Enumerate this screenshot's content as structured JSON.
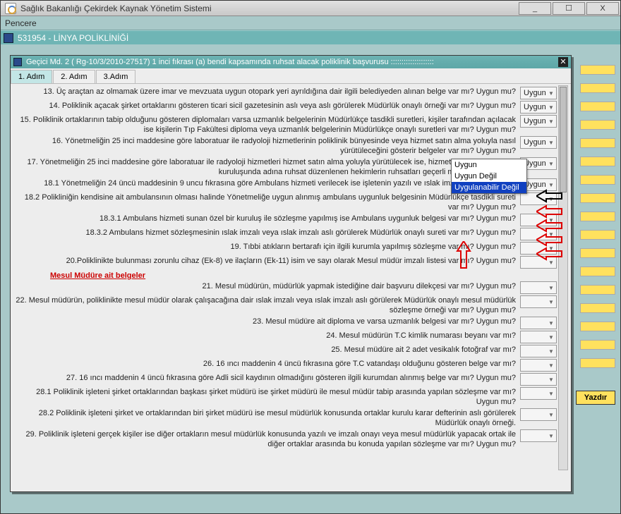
{
  "window": {
    "title": "Sağlık Bakanlığı Çekirdek Kaynak Yönetim Sistemi"
  },
  "menu": {
    "item1": "Pencere"
  },
  "subwindow": {
    "title": "531954 - LİNYA POLİKLİNİĞİ"
  },
  "dialog": {
    "title": "Geçici Md. 2 ( Rg-10/3/2010-27517)  1 inci fıkrası (a)  bendi kapsamında ruhsat alacak poliklinik başvurusu  ::::::::::::::::::::"
  },
  "tabs": [
    "1. Adım",
    "2. Adım",
    "3.Adım"
  ],
  "active_tab": 1,
  "questions": [
    {
      "id": "q13",
      "text": "13. Üç araçtan az olmamak üzere imar ve mevzuata uygun otopark yeri ayrıldığına dair ilgili belediyeden alınan belge var mı? Uygun mu?",
      "value": "Uygun"
    },
    {
      "id": "q14",
      "text": "14. Poliklinik açacak şirket ortaklarını gösteren ticari sicil gazetesinin aslı veya aslı görülerek Müdürlük onaylı örneği var mı? Uygun mu?",
      "value": "Uygun"
    },
    {
      "id": "q15",
      "text": "15. Poliklinik ortaklarının tabip olduğunu gösteren diplomaları varsa uzmanlık belgelerinin Müdürlükçe tasdikli suretleri, kişiler  tarafından açılacak ise kişilerin Tıp Fakültesi diploma veya uzmanlık belgelerinin Müdürlükçe onaylı suretleri var mı? Uygun mu?",
      "value": "Uygun"
    },
    {
      "id": "q16",
      "text": "16. Yönetmeliğin 25 inci maddesine göre laboratuar ile radyoloji hizmetlerinin poliklinik bünyesinde veya hizmet satın alma yoluyla nasıl yürütüleceğini gösterir belgeler var mı? Uygun mu?",
      "value": "Uygun"
    },
    {
      "id": "q17",
      "text": "17. Yönetmeliğin 25 inci maddesine göre laboratuar ile radyoloji hizmetleri hizmet satın alma yoluyla yürütülecek ise, hizmet satın alınan sağlık kuruluşunda adına ruhsat düzenlenen hekimlerin ruhsatları geçerli mi? (Faaliyette mi?)",
      "value": "Uygun"
    },
    {
      "id": "q181",
      "text": "18.1  Yönetmeliğin 24 üncü maddesinin 9 uncu fıkrasına göre Ambulans hizmeti verilecek ise işletenin yazılı ve ıslak imzalı beyanı var mı?",
      "value": "Uygun",
      "open": true
    },
    {
      "id": "q182",
      "text": "18.2  Polikliniğin kendisine ait ambulansının olması halinde Yönetmeliğe uygun alınmış ambulans uygunluk belgesinin Müdürlükçe tasdikli sureti var mı? Uygun mu?",
      "value": ""
    },
    {
      "id": "q1831",
      "text": "18.3.1  Ambulans hizmeti sunan özel bir kuruluş ile sözleşme yapılmış ise Ambulans uygunluk belgesi var mı? Uygun mu?",
      "value": ""
    },
    {
      "id": "q1832",
      "text": "18.3.2   Ambulans hizmet sözleşmesinin ıslak imzalı veya ıslak imzalı aslı görülerek Müdürlük onaylı sureti var mı? Uygun mu?",
      "value": ""
    },
    {
      "id": "q19",
      "text": "19. Tıbbi atıkların bertarafı için ilgili kurumla yapılmış sözleşme var mı? Uygun mu?",
      "value": ""
    },
    {
      "id": "q20",
      "text": "20.Poliklinikte bulunması zorunlu cihaz (Ek-8) ve ilaçların (Ek-11) isim ve sayı olarak Mesul müdür imzalı listesi var mı? Uygun mu?",
      "value": ""
    }
  ],
  "section_head": "Mesul Müdüre ait belgeler",
  "questions2": [
    {
      "id": "q21",
      "text": "21. Mesul müdürün, müdürlük yapmak istediğine dair başvuru dilekçesi var mı? Uygun mu?",
      "value": ""
    },
    {
      "id": "q22",
      "text": "22. Mesul müdürün, poliklinikte mesul müdür olarak çalışacağına dair ıslak imzalı veya ıslak imzalı aslı görülerek Müdürlük onaylı mesul müdürlük sözleşme örneği var mı? Uygun mu?",
      "value": ""
    },
    {
      "id": "q23",
      "text": "23. Mesul müdüre ait diploma ve varsa uzmanlık belgesi var mı? Uygun mu?",
      "value": ""
    },
    {
      "id": "q24",
      "text": "24. Mesul müdürün T.C kimlik numarası beyanı var mı?",
      "value": ""
    },
    {
      "id": "q25",
      "text": "25. Mesul müdüre ait 2 adet vesikalık fotoğraf var mı?",
      "value": ""
    },
    {
      "id": "q26",
      "text": "26. 16 ıncı maddenin 4 üncü fıkrasına göre T.C vatandaşı olduğunu gösteren belge var mı?",
      "value": ""
    },
    {
      "id": "q27",
      "text": "27. 16 ıncı maddenin 4 üncü fıkrasına göre Adli sicil kaydının olmadığını gösteren ilgili kurumdan alınmış belge var mı? Uygun mu?",
      "value": ""
    },
    {
      "id": "q281",
      "text": "28.1 Poliklinik işleteni şirket ortaklarından başkası şirket müdürü ise şirket müdürü ile mesul müdür tabip arasında yapılan sözleşme var mı? Uygun mu?",
      "value": ""
    },
    {
      "id": "q282",
      "text": "28.2  Poliklinik işleteni şirket ve ortaklarından biri şirket müdürü ise mesul müdürlük konusunda ortaklar kurulu karar defterinin aslı görülerek Müdürlük onaylı örneği.",
      "value": ""
    },
    {
      "id": "q29",
      "text": "29. Poliklinik işleteni gerçek kişiler ise diğer ortakların mesul müdürlük konusunda yazılı ve imzalı onayı veya mesul müdürlük yapacak ortak ile diğer ortaklar arasında bu konuda yapılan sözleşme var mı? Uygun mu?",
      "value": ""
    }
  ],
  "dropdown": {
    "options": [
      "Uygun",
      "Uygun Değil",
      "Uygulanabilir Değil"
    ],
    "highlighted": 2
  },
  "buttons": {
    "print": "Yazdır"
  }
}
